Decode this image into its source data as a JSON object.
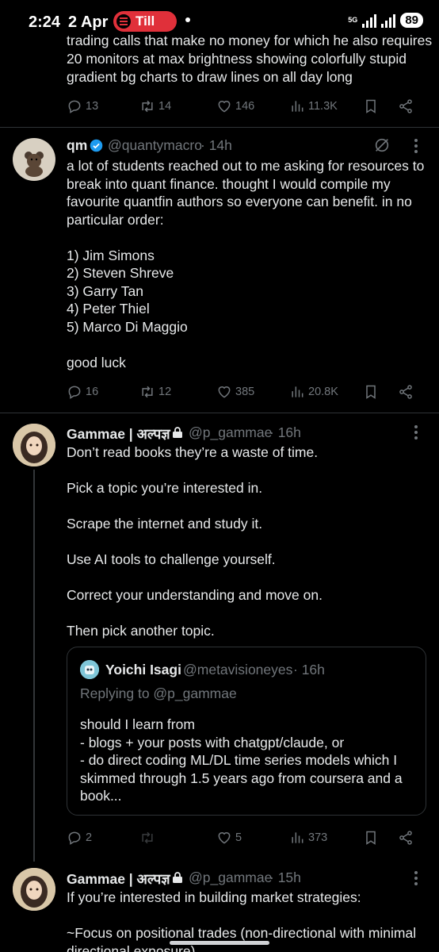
{
  "status_bar": {
    "time": "2:24",
    "date": "2 Apr",
    "media_pill": "Till",
    "network": "5G",
    "battery": "89"
  },
  "top_tweet": {
    "text_lines": [
      "trading calls that make no money for which he also requires",
      "20 monitors at max brightness showing colorfully stupid",
      "gradient bg charts to draw lines on all day long"
    ],
    "replies": "13",
    "retweets": "14",
    "likes": "146",
    "views": "11.3K"
  },
  "tweet_qm": {
    "name": "qm",
    "handle": "@quantymacro",
    "time": "· 14h",
    "text": "a lot of students reached out to me asking for resources to\nbreak into quant finance. thought I would compile my\nfavourite quantfin authors so everyone can benefit. in no\nparticular order:\n\n1) Jim Simons\n2) Steven Shreve\n3) Garry Tan\n4) Peter Thiel\n5) Marco Di Maggio\n\ngood luck",
    "replies": "16",
    "retweets": "12",
    "likes": "385",
    "views": "20.8K"
  },
  "tweet_gammae_1": {
    "name": "Gammae | अल्पज्ञ",
    "handle": "@p_gammae",
    "time": "· 16h",
    "text": "Don’t read books they’re a waste of time.\n\nPick a topic you’re interested in.\n\nScrape the internet and study it.\n\nUse AI tools to challenge yourself.\n\nCorrect your understanding and move on.\n\nThen pick another topic.",
    "quote": {
      "name": "Yoichi Isagi",
      "handle": "@metavisioneyes",
      "time": "· 16h",
      "replying_to": "Replying to @p_gammae",
      "text": "should I learn from\n- blogs + your posts with chatgpt/claude, or\n- do direct coding ML/DL time series models which I\nskimmed through 1.5 years ago from coursera and a\nbook..."
    },
    "replies": "2",
    "likes": "5",
    "views": "373"
  },
  "tweet_gammae_2": {
    "name": "Gammae | अल्पज्ञ",
    "handle": "@p_gammae",
    "time": "· 15h",
    "text": "If you’re interested in building market strategies:\n\n~Focus on positional trades (non-directional with minimal\ndirectional exposure)"
  },
  "colors": {
    "background": "#000000",
    "text": "#e7e9ea",
    "muted": "#71767b",
    "divider": "#2f3336",
    "verified": "#1d9bf0",
    "spotify_pill": "#e0303a"
  }
}
